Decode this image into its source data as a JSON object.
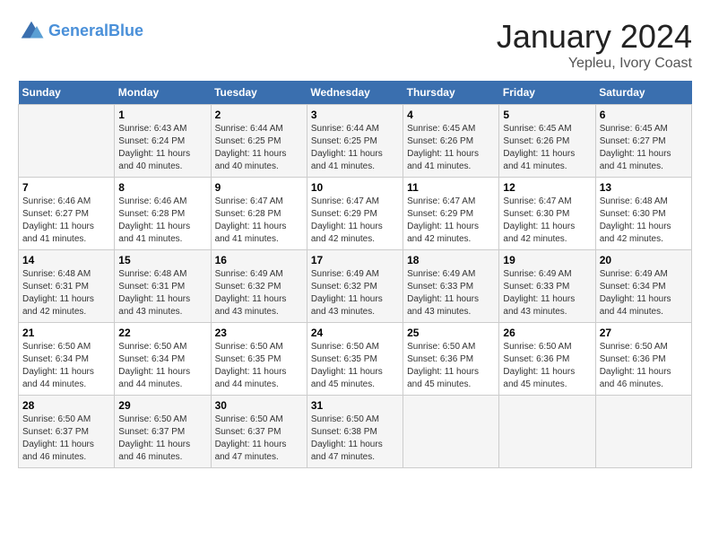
{
  "header": {
    "logo_line1": "General",
    "logo_line2": "Blue",
    "main_title": "January 2024",
    "subtitle": "Yepleu, Ivory Coast"
  },
  "days_of_week": [
    "Sunday",
    "Monday",
    "Tuesday",
    "Wednesday",
    "Thursday",
    "Friday",
    "Saturday"
  ],
  "weeks": [
    [
      {
        "day": "",
        "sunrise": "",
        "sunset": "",
        "daylight": ""
      },
      {
        "day": "1",
        "sunrise": "Sunrise: 6:43 AM",
        "sunset": "Sunset: 6:24 PM",
        "daylight": "Daylight: 11 hours and 40 minutes."
      },
      {
        "day": "2",
        "sunrise": "Sunrise: 6:44 AM",
        "sunset": "Sunset: 6:25 PM",
        "daylight": "Daylight: 11 hours and 40 minutes."
      },
      {
        "day": "3",
        "sunrise": "Sunrise: 6:44 AM",
        "sunset": "Sunset: 6:25 PM",
        "daylight": "Daylight: 11 hours and 41 minutes."
      },
      {
        "day": "4",
        "sunrise": "Sunrise: 6:45 AM",
        "sunset": "Sunset: 6:26 PM",
        "daylight": "Daylight: 11 hours and 41 minutes."
      },
      {
        "day": "5",
        "sunrise": "Sunrise: 6:45 AM",
        "sunset": "Sunset: 6:26 PM",
        "daylight": "Daylight: 11 hours and 41 minutes."
      },
      {
        "day": "6",
        "sunrise": "Sunrise: 6:45 AM",
        "sunset": "Sunset: 6:27 PM",
        "daylight": "Daylight: 11 hours and 41 minutes."
      }
    ],
    [
      {
        "day": "7",
        "sunrise": "Sunrise: 6:46 AM",
        "sunset": "Sunset: 6:27 PM",
        "daylight": "Daylight: 11 hours and 41 minutes."
      },
      {
        "day": "8",
        "sunrise": "Sunrise: 6:46 AM",
        "sunset": "Sunset: 6:28 PM",
        "daylight": "Daylight: 11 hours and 41 minutes."
      },
      {
        "day": "9",
        "sunrise": "Sunrise: 6:47 AM",
        "sunset": "Sunset: 6:28 PM",
        "daylight": "Daylight: 11 hours and 41 minutes."
      },
      {
        "day": "10",
        "sunrise": "Sunrise: 6:47 AM",
        "sunset": "Sunset: 6:29 PM",
        "daylight": "Daylight: 11 hours and 42 minutes."
      },
      {
        "day": "11",
        "sunrise": "Sunrise: 6:47 AM",
        "sunset": "Sunset: 6:29 PM",
        "daylight": "Daylight: 11 hours and 42 minutes."
      },
      {
        "day": "12",
        "sunrise": "Sunrise: 6:47 AM",
        "sunset": "Sunset: 6:30 PM",
        "daylight": "Daylight: 11 hours and 42 minutes."
      },
      {
        "day": "13",
        "sunrise": "Sunrise: 6:48 AM",
        "sunset": "Sunset: 6:30 PM",
        "daylight": "Daylight: 11 hours and 42 minutes."
      }
    ],
    [
      {
        "day": "14",
        "sunrise": "Sunrise: 6:48 AM",
        "sunset": "Sunset: 6:31 PM",
        "daylight": "Daylight: 11 hours and 42 minutes."
      },
      {
        "day": "15",
        "sunrise": "Sunrise: 6:48 AM",
        "sunset": "Sunset: 6:31 PM",
        "daylight": "Daylight: 11 hours and 43 minutes."
      },
      {
        "day": "16",
        "sunrise": "Sunrise: 6:49 AM",
        "sunset": "Sunset: 6:32 PM",
        "daylight": "Daylight: 11 hours and 43 minutes."
      },
      {
        "day": "17",
        "sunrise": "Sunrise: 6:49 AM",
        "sunset": "Sunset: 6:32 PM",
        "daylight": "Daylight: 11 hours and 43 minutes."
      },
      {
        "day": "18",
        "sunrise": "Sunrise: 6:49 AM",
        "sunset": "Sunset: 6:33 PM",
        "daylight": "Daylight: 11 hours and 43 minutes."
      },
      {
        "day": "19",
        "sunrise": "Sunrise: 6:49 AM",
        "sunset": "Sunset: 6:33 PM",
        "daylight": "Daylight: 11 hours and 43 minutes."
      },
      {
        "day": "20",
        "sunrise": "Sunrise: 6:49 AM",
        "sunset": "Sunset: 6:34 PM",
        "daylight": "Daylight: 11 hours and 44 minutes."
      }
    ],
    [
      {
        "day": "21",
        "sunrise": "Sunrise: 6:50 AM",
        "sunset": "Sunset: 6:34 PM",
        "daylight": "Daylight: 11 hours and 44 minutes."
      },
      {
        "day": "22",
        "sunrise": "Sunrise: 6:50 AM",
        "sunset": "Sunset: 6:34 PM",
        "daylight": "Daylight: 11 hours and 44 minutes."
      },
      {
        "day": "23",
        "sunrise": "Sunrise: 6:50 AM",
        "sunset": "Sunset: 6:35 PM",
        "daylight": "Daylight: 11 hours and 44 minutes."
      },
      {
        "day": "24",
        "sunrise": "Sunrise: 6:50 AM",
        "sunset": "Sunset: 6:35 PM",
        "daylight": "Daylight: 11 hours and 45 minutes."
      },
      {
        "day": "25",
        "sunrise": "Sunrise: 6:50 AM",
        "sunset": "Sunset: 6:36 PM",
        "daylight": "Daylight: 11 hours and 45 minutes."
      },
      {
        "day": "26",
        "sunrise": "Sunrise: 6:50 AM",
        "sunset": "Sunset: 6:36 PM",
        "daylight": "Daylight: 11 hours and 45 minutes."
      },
      {
        "day": "27",
        "sunrise": "Sunrise: 6:50 AM",
        "sunset": "Sunset: 6:36 PM",
        "daylight": "Daylight: 11 hours and 46 minutes."
      }
    ],
    [
      {
        "day": "28",
        "sunrise": "Sunrise: 6:50 AM",
        "sunset": "Sunset: 6:37 PM",
        "daylight": "Daylight: 11 hours and 46 minutes."
      },
      {
        "day": "29",
        "sunrise": "Sunrise: 6:50 AM",
        "sunset": "Sunset: 6:37 PM",
        "daylight": "Daylight: 11 hours and 46 minutes."
      },
      {
        "day": "30",
        "sunrise": "Sunrise: 6:50 AM",
        "sunset": "Sunset: 6:37 PM",
        "daylight": "Daylight: 11 hours and 47 minutes."
      },
      {
        "day": "31",
        "sunrise": "Sunrise: 6:50 AM",
        "sunset": "Sunset: 6:38 PM",
        "daylight": "Daylight: 11 hours and 47 minutes."
      },
      {
        "day": "",
        "sunrise": "",
        "sunset": "",
        "daylight": ""
      },
      {
        "day": "",
        "sunrise": "",
        "sunset": "",
        "daylight": ""
      },
      {
        "day": "",
        "sunrise": "",
        "sunset": "",
        "daylight": ""
      }
    ]
  ]
}
